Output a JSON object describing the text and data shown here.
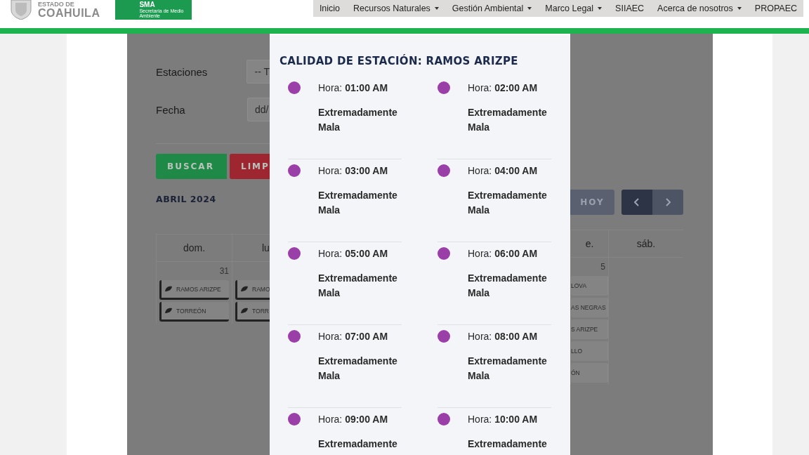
{
  "header": {
    "state_top": "ESTADO DE",
    "state_name": "COAHUILA",
    "agency": {
      "acronym": "SMA",
      "subtitle": "Secretaría de Medio Ambiente"
    }
  },
  "nav": [
    {
      "label": "Inicio",
      "dropdown": false
    },
    {
      "label": "Recursos Naturales",
      "dropdown": true
    },
    {
      "label": "Gestión Ambiental",
      "dropdown": true
    },
    {
      "label": "Marco Legal",
      "dropdown": true
    },
    {
      "label": "SIIAEC",
      "dropdown": false
    },
    {
      "label": "Acerca de nosotros",
      "dropdown": true
    },
    {
      "label": "PROPAEC",
      "dropdown": false
    }
  ],
  "form": {
    "fields": [
      {
        "label": "Estaciones",
        "value": "-- T"
      },
      {
        "label": "Fecha",
        "value": "dd/"
      }
    ],
    "buttons": [
      {
        "label": "BUSCAR",
        "kind": "success"
      },
      {
        "label": "LIMP",
        "kind": "danger"
      }
    ]
  },
  "calendar": {
    "title": "ABRIL 2024",
    "today_button": "HOY",
    "left_columns": [
      {
        "header": "dom.",
        "day": "31",
        "events": [
          "RAMOS ARIZPE",
          "TORREÓN"
        ]
      },
      {
        "header": "lu",
        "events": [
          "RAMO",
          "TORR"
        ]
      }
    ],
    "right_columns": [
      {
        "header": "e.",
        "day": "5",
        "events": [
          "LOVA",
          "AS NEGRAS",
          "S ARIZPE",
          "LLO",
          "ÓN"
        ]
      },
      {
        "header": "sáb."
      }
    ]
  },
  "modal": {
    "title": "CALIDAD DE ESTACIÓN: RAMOS ARIZPE",
    "readings": [
      {
        "label": "Hora:",
        "time": "01:00 AM",
        "quality": "Extremadamente Mala",
        "color": "#9b3fa8"
      },
      {
        "label": "Hora:",
        "time": "02:00 AM",
        "quality": "Extremadamente Mala",
        "color": "#9b3fa8"
      },
      {
        "label": "Hora:",
        "time": "03:00 AM",
        "quality": "Extremadamente Mala",
        "color": "#9b3fa8"
      },
      {
        "label": "Hora:",
        "time": "04:00 AM",
        "quality": "Extremadamente Mala",
        "color": "#9b3fa8"
      },
      {
        "label": "Hora:",
        "time": "05:00 AM",
        "quality": "Extremadamente Mala",
        "color": "#9b3fa8"
      },
      {
        "label": "Hora:",
        "time": "06:00 AM",
        "quality": "Extremadamente Mala",
        "color": "#9b3fa8"
      },
      {
        "label": "Hora:",
        "time": "07:00 AM",
        "quality": "Extremadamente Mala",
        "color": "#9b3fa8"
      },
      {
        "label": "Hora:",
        "time": "08:00 AM",
        "quality": "Extremadamente Mala",
        "color": "#9b3fa8"
      },
      {
        "label": "Hora:",
        "time": "09:00 AM",
        "quality": "Extremadamente",
        "color": "#9b3fa8"
      },
      {
        "label": "Hora:",
        "time": "10:00 AM",
        "quality": "Extremadamente",
        "color": "#9b3fa8"
      }
    ]
  }
}
